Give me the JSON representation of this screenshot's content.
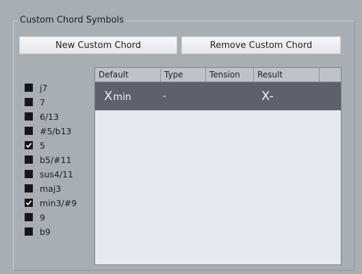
{
  "group_title": "Custom Chord Symbols",
  "buttons": {
    "new_label": "New Custom Chord",
    "remove_label": "Remove Custom Chord"
  },
  "extensions": [
    {
      "label": "j7",
      "checked": false
    },
    {
      "label": "7",
      "checked": false
    },
    {
      "label": "6/13",
      "checked": false
    },
    {
      "label": "#5/b13",
      "checked": false
    },
    {
      "label": "5",
      "checked": true
    },
    {
      "label": "b5/#11",
      "checked": false
    },
    {
      "label": "sus4/11",
      "checked": false
    },
    {
      "label": "maj3",
      "checked": false
    },
    {
      "label": "min3/#9",
      "checked": true
    },
    {
      "label": "9",
      "checked": false
    },
    {
      "label": "b9",
      "checked": false
    }
  ],
  "table": {
    "columns": {
      "default": "Default",
      "type": "Type",
      "tension": "Tension",
      "result": "Result"
    },
    "rows": [
      {
        "default_root": "X",
        "default_suffix": "min",
        "type": "-",
        "tension": "",
        "result": "X-"
      }
    ]
  }
}
